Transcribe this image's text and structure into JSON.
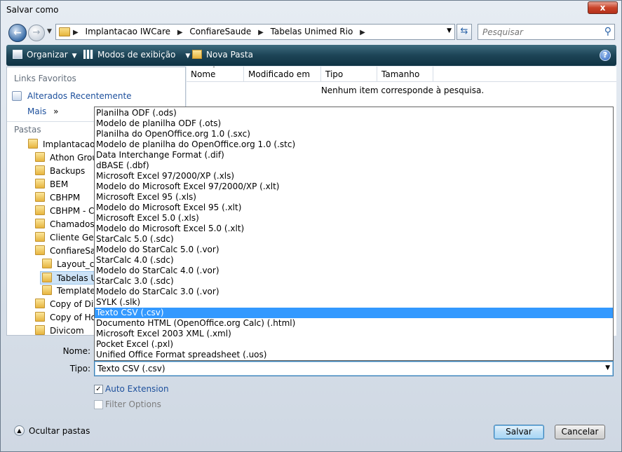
{
  "window": {
    "title": "Salvar como",
    "close_label": "x"
  },
  "address_bar": {
    "crumbs": [
      "Implantacao IWCare",
      "ConfiareSaude",
      "Tabelas Unimed Rio"
    ],
    "search_placeholder": "Pesquisar"
  },
  "toolbar": {
    "organize_label": "Organizar",
    "views_label": "Modos de exibição",
    "new_folder_label": "Nova Pasta",
    "help_label": "?"
  },
  "left_pane": {
    "favorites_heading": "Links Favoritos",
    "recent_label": "Alterados Recentemente",
    "more_label": "Mais",
    "more_chevron": "»",
    "folders_heading": "Pastas",
    "tree": [
      "Implantacao IWCare",
      "Athon Group",
      "Backups",
      "BEM",
      "CBHPM",
      "CBHPM - CD",
      "Chamados",
      "Cliente Generico",
      "ConfiareSaude",
      "Layout_ca",
      "Tabelas Unimed Rio",
      "Templates",
      "Copy of Divi",
      "Copy of Hos",
      "Divicom"
    ]
  },
  "file_list": {
    "columns": [
      "Nome",
      "Modificado em",
      "Tipo",
      "Tamanho"
    ],
    "empty_message": "Nenhum item corresponde à pesquisa."
  },
  "form": {
    "name_label": "Nome:",
    "type_label": "Tipo:",
    "type_value": "Texto CSV (.csv)",
    "auto_extension_label": "Auto Extension",
    "auto_extension_checked": true,
    "filter_options_label": "Filter Options",
    "filter_options_checked": false
  },
  "type_options": [
    "Planilha ODF (.ods)",
    "Modelo de planilha ODF (.ots)",
    "Planilha do OpenOffice.org 1.0 (.sxc)",
    "Modelo de planilha do OpenOffice.org 1.0 (.stc)",
    "Data Interchange Format (.dif)",
    "dBASE (.dbf)",
    "Microsoft Excel 97/2000/XP (.xls)",
    "Modelo do Microsoft Excel 97/2000/XP (.xlt)",
    "Microsoft Excel 95 (.xls)",
    "Modelo do Microsoft Excel 95 (.xlt)",
    "Microsoft Excel 5.0 (.xls)",
    "Modelo do Microsoft Excel 5.0 (.xlt)",
    "StarCalc 5.0 (.sdc)",
    "Modelo do StarCalc 5.0 (.vor)",
    "StarCalc 4.0 (.sdc)",
    "Modelo do StarCalc 4.0 (.vor)",
    "StarCalc 3.0 (.sdc)",
    "Modelo do StarCalc 3.0 (.vor)",
    "SYLK (.slk)",
    "Texto CSV (.csv)",
    "Documento HTML (OpenOffice.org Calc) (.html)",
    "Microsoft Excel 2003 XML (.xml)",
    "Pocket Excel (.pxl)",
    "Unified Office Format spreadsheet (.uos)"
  ],
  "selected_type_index": 19,
  "footer": {
    "hide_folders_label": "Ocultar pastas",
    "save_label": "Salvar",
    "cancel_label": "Cancelar"
  }
}
